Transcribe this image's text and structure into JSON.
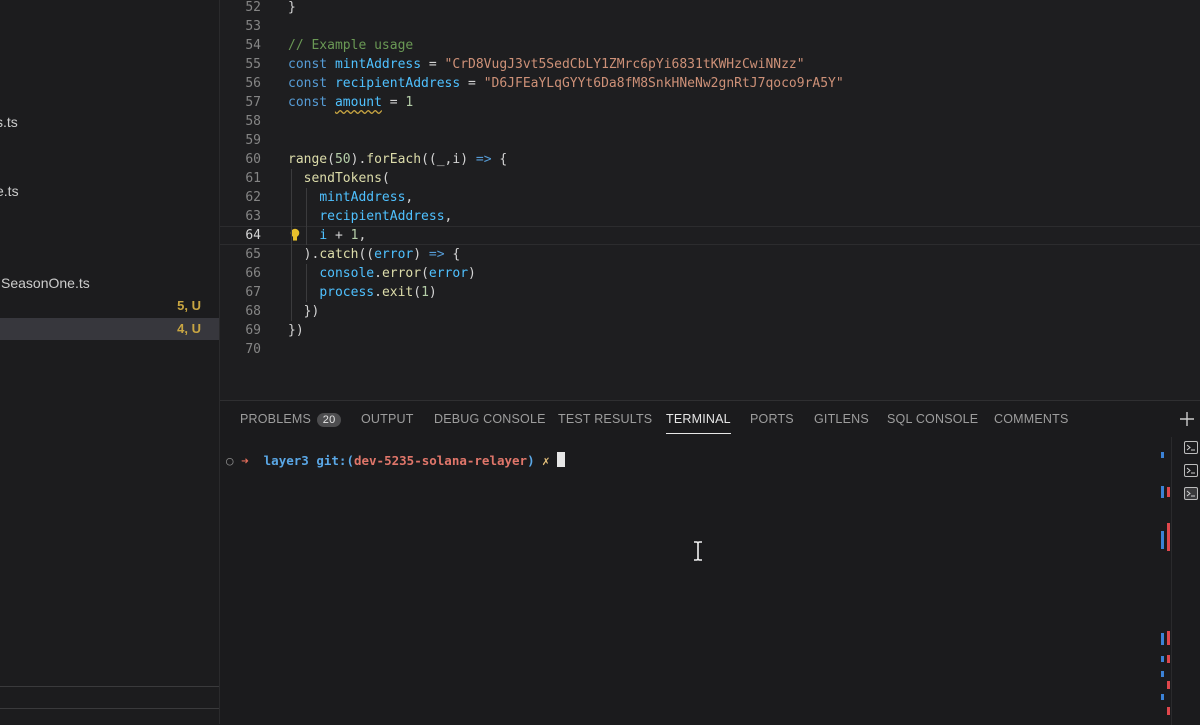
{
  "sidebar": {
    "files": [
      {
        "name": "s.ts"
      },
      {
        "name": "e.ts"
      },
      {
        "name": "SeasonOne.ts"
      }
    ],
    "rows": [
      {
        "badge": "5, U",
        "active": false
      },
      {
        "badge": "4, U",
        "active": true
      }
    ]
  },
  "editor": {
    "current_line": "64",
    "lines": [
      {
        "n": "52",
        "tokens": [
          [
            "}",
            "plain"
          ]
        ]
      },
      {
        "n": "53",
        "tokens": []
      },
      {
        "n": "54",
        "tokens": [
          [
            "// Example usage",
            "cm"
          ]
        ]
      },
      {
        "n": "55",
        "tokens": [
          [
            "const ",
            "kw"
          ],
          [
            "mintAddress",
            "var"
          ],
          [
            " = ",
            "plain"
          ],
          [
            "\"CrD8VugJ3vt5SedCbLY1ZMrc6pYi6831tKWHzCwiNNzz\"",
            "str"
          ]
        ]
      },
      {
        "n": "56",
        "tokens": [
          [
            "const ",
            "kw"
          ],
          [
            "recipientAddress",
            "var"
          ],
          [
            " = ",
            "plain"
          ],
          [
            "\"D6JFEaYLqGYYt6Da8fM8SnkHNeNw2gnRtJ7qoco9rA5Y\"",
            "str"
          ]
        ]
      },
      {
        "n": "57",
        "tokens": [
          [
            "const ",
            "kw"
          ],
          [
            "amount",
            "var squig"
          ],
          [
            " = ",
            "plain"
          ],
          [
            "1",
            "num"
          ]
        ]
      },
      {
        "n": "58",
        "tokens": []
      },
      {
        "n": "59",
        "tokens": []
      },
      {
        "n": "60",
        "tokens": [
          [
            "range",
            "fn"
          ],
          [
            "(",
            "plain"
          ],
          [
            "50",
            "num"
          ],
          [
            ").",
            "plain"
          ],
          [
            "forEach",
            "fn"
          ],
          [
            "((_,i) ",
            "plain"
          ],
          [
            "=>",
            "kw"
          ],
          [
            " {",
            "plain"
          ]
        ]
      },
      {
        "n": "61",
        "tokens": [
          [
            "  ",
            "plain"
          ],
          [
            "sendTokens",
            "fn"
          ],
          [
            "(",
            "plain"
          ]
        ]
      },
      {
        "n": "62",
        "tokens": [
          [
            "    ",
            "plain"
          ],
          [
            "mintAddress",
            "var"
          ],
          [
            ",",
            "plain"
          ]
        ]
      },
      {
        "n": "63",
        "tokens": [
          [
            "    ",
            "plain"
          ],
          [
            "recipientAddress",
            "var"
          ],
          [
            ",",
            "plain"
          ]
        ]
      },
      {
        "n": "64",
        "tokens": [
          [
            "    ",
            "plain"
          ],
          [
            "i",
            "var"
          ],
          [
            " + ",
            "plain"
          ],
          [
            "1",
            "num"
          ],
          [
            ",",
            "plain"
          ]
        ]
      },
      {
        "n": "65",
        "tokens": [
          [
            "  ).",
            "plain"
          ],
          [
            "catch",
            "fn"
          ],
          [
            "((",
            "plain"
          ],
          [
            "error",
            "var"
          ],
          [
            ") ",
            "plain"
          ],
          [
            "=>",
            "kw"
          ],
          [
            " {",
            "plain"
          ]
        ]
      },
      {
        "n": "66",
        "tokens": [
          [
            "    ",
            "plain"
          ],
          [
            "console",
            "var"
          ],
          [
            ".",
            "plain"
          ],
          [
            "error",
            "fn"
          ],
          [
            "(",
            "plain"
          ],
          [
            "error",
            "var"
          ],
          [
            ")",
            "plain"
          ]
        ]
      },
      {
        "n": "67",
        "tokens": [
          [
            "    ",
            "plain"
          ],
          [
            "process",
            "var"
          ],
          [
            ".",
            "plain"
          ],
          [
            "exit",
            "fn"
          ],
          [
            "(",
            "plain"
          ],
          [
            "1",
            "num"
          ],
          [
            ")",
            "plain"
          ]
        ]
      },
      {
        "n": "68",
        "tokens": [
          [
            "  })",
            "plain"
          ]
        ]
      },
      {
        "n": "69",
        "tokens": [
          [
            "})",
            "plain"
          ]
        ]
      },
      {
        "n": "70",
        "tokens": []
      }
    ]
  },
  "panel": {
    "tabs": [
      {
        "label": "PROBLEMS",
        "badge": "20"
      },
      {
        "label": "OUTPUT"
      },
      {
        "label": "DEBUG CONSOLE"
      },
      {
        "label": "TEST RESULTS"
      },
      {
        "label": "TERMINAL",
        "active": true
      },
      {
        "label": "PORTS"
      },
      {
        "label": "GITLENS"
      },
      {
        "label": "SQL CONSOLE"
      },
      {
        "label": "COMMENTS"
      }
    ],
    "add_icon": "plus-icon",
    "terminal": {
      "dot": "○",
      "arrow": "➜",
      "dir": "layer3",
      "git": "git:(",
      "branch": "dev-5235-solana-relayer",
      "git_close": ")",
      "dirty": "✗"
    }
  },
  "colors": {
    "accent_badge": "#c9a642",
    "string": "#ce9178",
    "keyword": "#569cd6"
  }
}
